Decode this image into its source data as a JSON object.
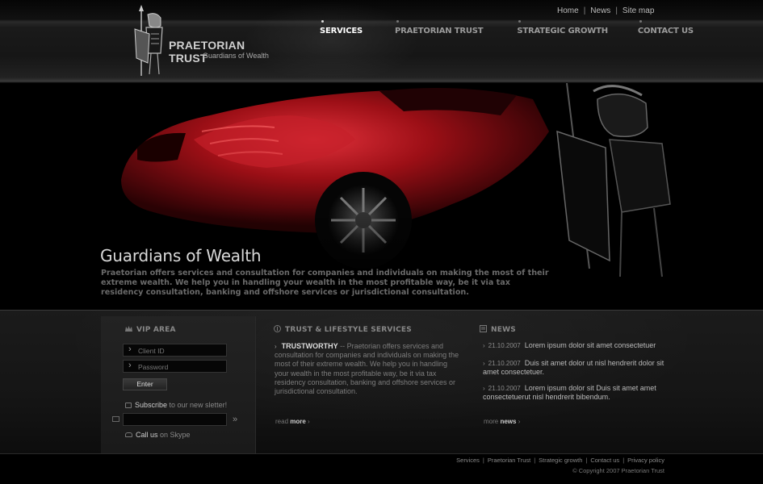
{
  "top_links": [
    {
      "label": "Home"
    },
    {
      "label": "News"
    },
    {
      "label": "Site map"
    }
  ],
  "top_links_sep": "|",
  "logo": {
    "title": "PRAETORIAN TRUST",
    "subtitle": "Guardians of Wealth"
  },
  "nav": [
    {
      "label": "SERVICES",
      "active": true
    },
    {
      "label": "PRAETORIAN TRUST",
      "active": false
    },
    {
      "label": "STRATEGIC GROWTH",
      "active": false
    },
    {
      "label": "CONTACT US",
      "active": false
    }
  ],
  "hero": {
    "title": "Guardians of Wealth",
    "text": "Praetorian offers services and consultation for companies and individuals on making the most of their extreme wealth.  We help you in handling your wealth in the most profitable way, be it via tax residency consultation, banking and offshore services or jurisdictional consultation."
  },
  "vip": {
    "title": "VIP AREA",
    "client_id_placeholder": "Client ID",
    "password_placeholder": "Password",
    "enter_label": "Enter",
    "subscribe_strong": "Subscribe",
    "subscribe_rest": " to our new sletter!",
    "skype_strong": "Call us",
    "skype_rest": " on Skype"
  },
  "trust": {
    "title": "TRUST & LIFESTYLE SERVICES",
    "lead": "TRUSTWORTHY",
    "text": " -- Praetorian offers services and consultation for companies and individuals on making the most of their extreme wealth.  We help you in handling your wealth in the most profitable way, be it via tax residency consultation, banking and offshore services or jurisdictional consultation.",
    "read_pre": "read ",
    "read_strong": "more"
  },
  "news": {
    "title": "NEWS",
    "items": [
      {
        "date": "21.10.2007",
        "text": "Lorem ipsum dolor sit amet consectetuer"
      },
      {
        "date": "21.10.2007",
        "text": "Duis sit amet dolor ut nisl hendrerit dolor sit amet consectetuer."
      },
      {
        "date": "21.10.2007",
        "text": "Lorem ipsum dolor sit Duis sit amet amet consectetuerut nisl hendrerit bibendum."
      }
    ],
    "more_pre": "more ",
    "more_strong": "news"
  },
  "footer": {
    "links": [
      "Services",
      "Praetorian Trust",
      "Strategic growth",
      "Contact us",
      "Privacy policy"
    ],
    "sep": "|",
    "copyright": "© Copyright 2007 Praetorian Trust"
  },
  "colors": {
    "accent_red": "#b0121a",
    "background": "#000000"
  }
}
